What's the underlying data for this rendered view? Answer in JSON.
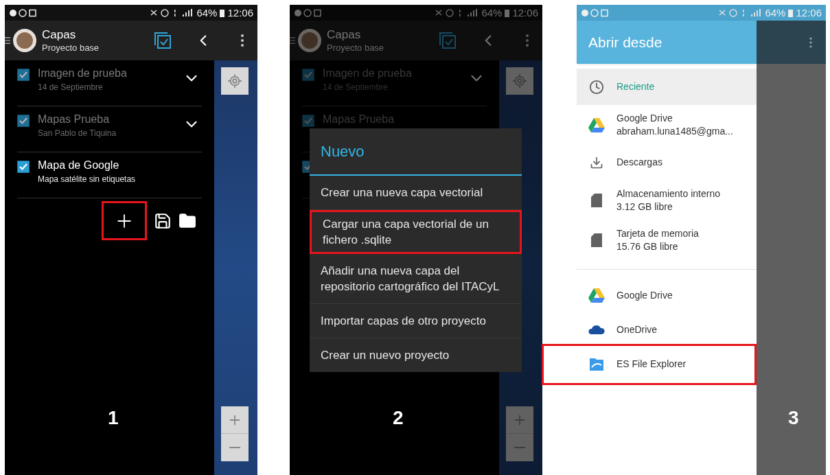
{
  "panels": [
    {
      "kind": "layers",
      "step": "1",
      "status": {
        "battery": "64%",
        "time": "12:06"
      },
      "app_bar": {
        "title": "Capas",
        "subtitle": "Proyecto base"
      },
      "layers": [
        {
          "title": "Imagen de prueba",
          "subtitle": "14 de Septiembre",
          "checked": true,
          "active": false,
          "expandable": true
        },
        {
          "title": "Mapas Prueba",
          "subtitle": "San Pablo de Tiquina",
          "checked": true,
          "active": false,
          "expandable": true
        },
        {
          "title": "Mapa de Google",
          "subtitle": "Mapa satélite sin etiquetas",
          "checked": true,
          "active": true,
          "expandable": false
        }
      ],
      "toolbar": {
        "add_highlighted": true
      },
      "dimmed": false
    },
    {
      "kind": "layers",
      "step": "2",
      "status": {
        "battery": "64%",
        "time": "12:06"
      },
      "app_bar": {
        "title": "Capas",
        "subtitle": "Proyecto base"
      },
      "layers": [
        {
          "title": "Imagen de prueba",
          "subtitle": "14 de Septiembre",
          "checked": true,
          "active": false,
          "expandable": true
        },
        {
          "title": "Mapas Prueba",
          "checked": true,
          "active": false,
          "expandable": false
        },
        {
          "checked": true,
          "expandable": false
        }
      ],
      "dimmed": true,
      "dialog": {
        "title": "Nuevo",
        "items": [
          {
            "label": "Crear una nueva capa vectorial",
            "highlighted": false
          },
          {
            "label": "Cargar una capa vectorial de un fichero .sqlite",
            "highlighted": true
          },
          {
            "label": "Añadir una nueva capa del repositorio cartográfico del ITACyL",
            "highlighted": false
          },
          {
            "label": "Importar capas de otro proyecto",
            "highlighted": false
          },
          {
            "label": "Crear un nuevo proyecto",
            "highlighted": false
          }
        ]
      }
    },
    {
      "kind": "picker",
      "step": "3",
      "status": {
        "battery": "64%",
        "time": "12:06"
      },
      "title": "Abrir desde",
      "locations": [
        {
          "label": "Reciente",
          "selected": true
        },
        {
          "label": "Google Drive",
          "detail": "abraham.luna1485@gma...",
          "selected": false
        },
        {
          "label": "Descargas",
          "selected": false
        },
        {
          "label": "Almacenamiento interno",
          "detail": "3.12 GB libre",
          "selected": false
        },
        {
          "label": "Tarjeta de memoria",
          "detail": "15.76 GB libre",
          "selected": false
        }
      ],
      "apps": [
        {
          "label": "Google Drive",
          "highlighted": false
        },
        {
          "label": "OneDrive",
          "highlighted": false
        },
        {
          "label": "ES File Explorer",
          "highlighted": true
        }
      ]
    }
  ]
}
